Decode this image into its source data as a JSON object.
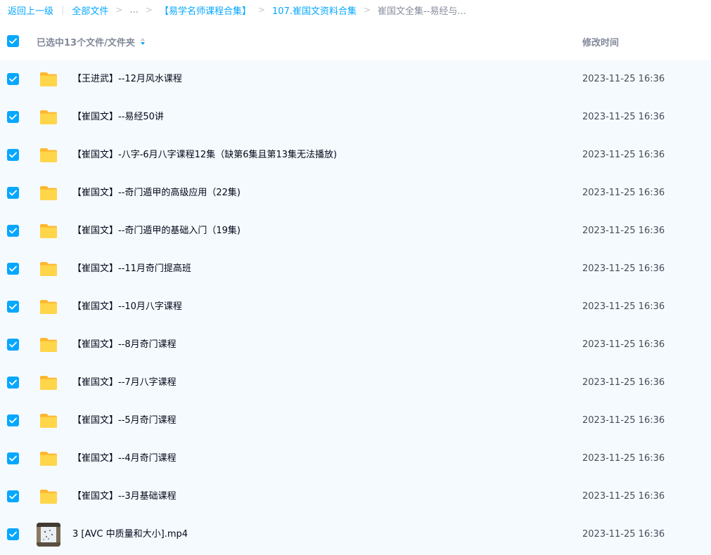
{
  "breadcrumb": {
    "back_label": "返回上一级",
    "all_files_label": "全部文件",
    "ellipsis": "...",
    "level1_label": "【易学名师课程合集】",
    "level2_label": "107.崔国文资料合集",
    "current_label": "崔国文全集--易经与..."
  },
  "header": {
    "selection_label": "已选中13个文件/文件夹",
    "modified_time_label": "修改时间",
    "sort_state": "descending"
  },
  "colors": {
    "accent": "#06a7ff",
    "row_background": "#f5fafe",
    "folder_yellow": "#ffc430"
  },
  "files": [
    {
      "name": "【王进武】--12月风水课程",
      "modified": "2023-11-25 16:36",
      "type": "folder",
      "checked": true
    },
    {
      "name": "【崔国文】--易经50讲",
      "modified": "2023-11-25 16:36",
      "type": "folder",
      "checked": true
    },
    {
      "name": "【崔国文】-八字-6月八字课程12集（缺第6集且第13集无法播放)",
      "modified": "2023-11-25 16:36",
      "type": "folder",
      "checked": true
    },
    {
      "name": "【崔国文】--奇门遁甲的高级应用（22集)",
      "modified": "2023-11-25 16:36",
      "type": "folder",
      "checked": true
    },
    {
      "name": "【崔国文】--奇门遁甲的基础入门（19集)",
      "modified": "2023-11-25 16:36",
      "type": "folder",
      "checked": true
    },
    {
      "name": "【崔国文】--11月奇门提高班",
      "modified": "2023-11-25 16:36",
      "type": "folder",
      "checked": true
    },
    {
      "name": "【崔国文】--10月八字课程",
      "modified": "2023-11-25 16:36",
      "type": "folder",
      "checked": true
    },
    {
      "name": "【崔国文】--8月奇门课程",
      "modified": "2023-11-25 16:36",
      "type": "folder",
      "checked": true
    },
    {
      "name": "【崔国文】--7月八字课程",
      "modified": "2023-11-25 16:36",
      "type": "folder",
      "checked": true
    },
    {
      "name": "【崔国文】--5月奇门课程",
      "modified": "2023-11-25 16:36",
      "type": "folder",
      "checked": true
    },
    {
      "name": "【崔国文】--4月奇门课程",
      "modified": "2023-11-25 16:36",
      "type": "folder",
      "checked": true
    },
    {
      "name": "【崔国文】--3月基础课程",
      "modified": "2023-11-25 16:36",
      "type": "folder",
      "checked": true
    },
    {
      "name": "3 [AVC 中质量和大小].mp4",
      "modified": "2023-11-25 16:36",
      "type": "video",
      "checked": true
    }
  ]
}
